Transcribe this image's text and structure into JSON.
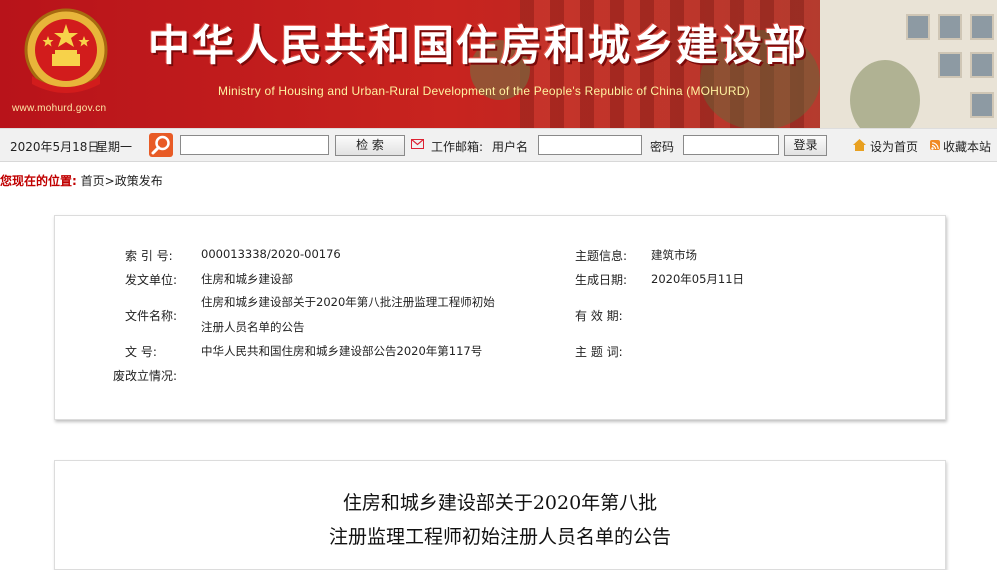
{
  "header": {
    "title_cn": "中华人民共和国住房和城乡建设部",
    "title_en": "Ministry of Housing and Urban-Rural Development of the People's Republic of China (MOHURD)",
    "site_url": "www.mohurd.gov.cn"
  },
  "toolbar": {
    "date": "2020年5月18日",
    "weekday": "星期一",
    "search_placeholder": "",
    "search_button": "检 索",
    "mail_label": "工作邮箱:",
    "username_label": "用户名",
    "password_label": "密码",
    "login_button": "登录",
    "set_home": "设为首页",
    "bookmark": "收藏本站"
  },
  "breadcrumb": {
    "label": "您现在的位置:",
    "home": "首页",
    "separator": ">",
    "current": "政策发布"
  },
  "meta": {
    "index_label": "索 引 号:",
    "index_value": "000013338/2020-00176",
    "topic_label": "主题信息:",
    "topic_value": "建筑市场",
    "issuer_label": "发文单位:",
    "issuer_value": "住房和城乡建设部",
    "date_label": "生成日期:",
    "date_value": "2020年05月11日",
    "filename_label": "文件名称:",
    "filename_line1": "住房和城乡建设部关于2020年第八批注册监理工程师初始",
    "filename_line2": "注册人员名单的公告",
    "validity_label": "有 效 期:",
    "validity_value": "",
    "docno_label": "文 号:",
    "docno_value": "中华人民共和国住房和城乡建设部公告2020年第117号",
    "subject_label": "主 题 词:",
    "subject_value": "",
    "repeal_label": "废改立情况:",
    "repeal_value": ""
  },
  "article": {
    "title_line1": "住房和城乡建设部关于2020年第八批",
    "title_line2": "注册监理工程师初始注册人员名单的公告"
  },
  "colors": {
    "banner_red": "#c8241f",
    "breadcrumb_label": "#c00000",
    "search_icon_bg": "#e85b26"
  }
}
